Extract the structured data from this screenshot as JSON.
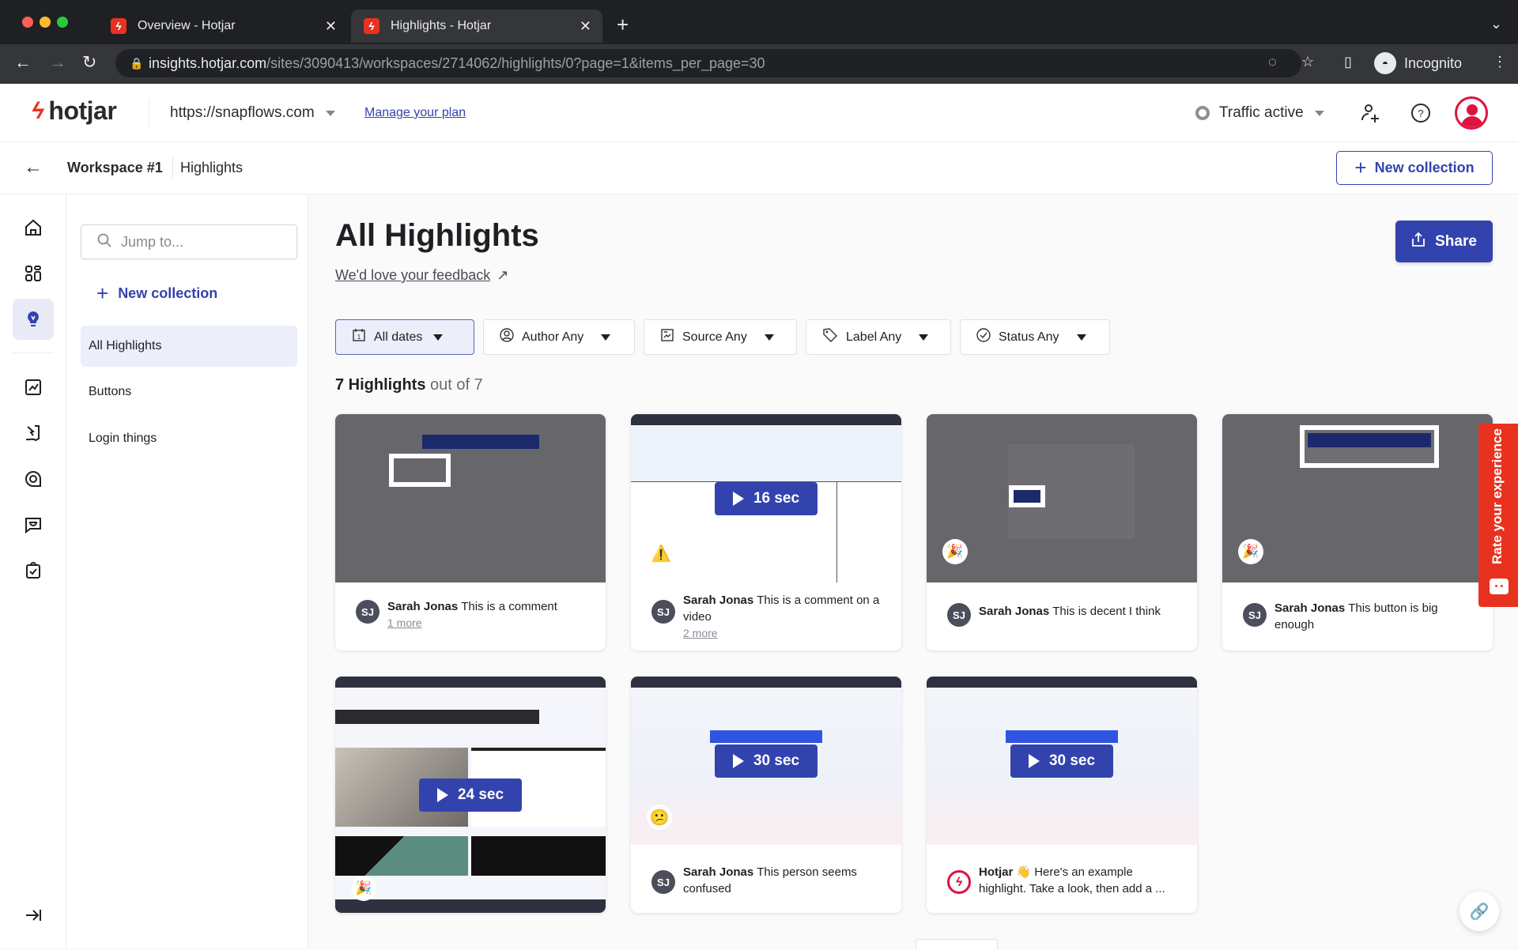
{
  "browser": {
    "tabs": [
      {
        "title": "Overview - Hotjar",
        "active": false
      },
      {
        "title": "Highlights - Hotjar",
        "active": true
      }
    ],
    "url_host": "insights.hotjar.com",
    "url_path": "/sites/3090413/workspaces/2714062/highlights/0?page=1&items_per_page=30",
    "profile_label": "Incognito"
  },
  "header": {
    "logo_text": "hotjar",
    "site": "https://snapflows.com",
    "manage_plan": "Manage your plan",
    "traffic_status": "Traffic active"
  },
  "subheader": {
    "breadcrumb": [
      "Workspace #1",
      "Highlights"
    ],
    "new_collection": "New collection"
  },
  "rail": {
    "icons": [
      "home-icon",
      "dashboard-icon",
      "highlights-icon",
      "trends-icon",
      "recordings-icon",
      "feedback-icon",
      "surveys-icon",
      "interviews-icon"
    ],
    "active": "highlights-icon",
    "collapse_icon": "collapse-icon"
  },
  "sidebar": {
    "search_placeholder": "Jump to...",
    "new_collection": "New collection",
    "items": [
      {
        "label": "All Highlights",
        "active": true
      },
      {
        "label": "Buttons",
        "active": false
      },
      {
        "label": "Login things",
        "active": false
      }
    ]
  },
  "main": {
    "title": "All Highlights",
    "feedback_link": "We'd love your feedback",
    "share_label": "Share",
    "filters": [
      {
        "label": "All dates",
        "icon": "calendar-icon",
        "active": true
      },
      {
        "label": "Author Any",
        "icon": "user-icon",
        "active": false
      },
      {
        "label": "Source Any",
        "icon": "source-icon",
        "active": false
      },
      {
        "label": "Label Any",
        "icon": "tag-icon",
        "active": false
      },
      {
        "label": "Status Any",
        "icon": "check-circle-icon",
        "active": false
      }
    ],
    "count_bold": "7 Highlights",
    "count_rest": "out of 7"
  },
  "highlights": [
    {
      "author": "Sarah Jonas",
      "initials": "SJ",
      "comment": "This is a comment",
      "more": "1 more",
      "type": "heatmap",
      "duration": null,
      "badge": null
    },
    {
      "author": "Sarah Jonas",
      "initials": "SJ",
      "comment": "This is a comment on a video",
      "more": "2 more",
      "type": "recording",
      "duration": "16 sec",
      "badge": "warning"
    },
    {
      "author": "Sarah Jonas",
      "initials": "SJ",
      "comment": "This is decent I think",
      "more": null,
      "type": "heatmap",
      "duration": null,
      "badge": "party"
    },
    {
      "author": "Sarah Jonas",
      "initials": "SJ",
      "comment": "This button is big enough",
      "more": null,
      "type": "heatmap",
      "duration": null,
      "badge": "party"
    },
    {
      "author": null,
      "initials": null,
      "comment": null,
      "more": null,
      "type": "recording",
      "duration": "24 sec",
      "badge": "party"
    },
    {
      "author": "Sarah Jonas",
      "initials": "SJ",
      "comment": "This person seems confused",
      "more": null,
      "type": "recording",
      "duration": "30 sec",
      "badge": "confused"
    },
    {
      "author": "Hotjar",
      "initials": "",
      "comment": "👋 Here's an example highlight. Take a look, then add a ...",
      "more": null,
      "type": "recording",
      "duration": "30 sec",
      "badge": null
    }
  ],
  "widgets": {
    "rate_experience": "Rate your experience"
  },
  "colors": {
    "brand_blue": "#3343ad",
    "hotjar_red": "#e8321f",
    "avatar_red": "#e0123f"
  }
}
